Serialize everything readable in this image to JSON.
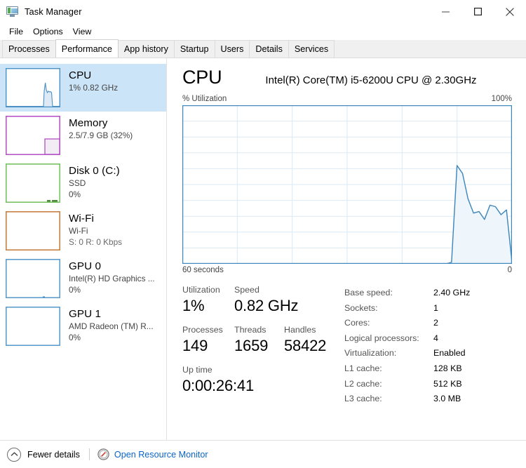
{
  "window": {
    "title": "Task Manager",
    "icon": "task-manager-icon",
    "controls": {
      "minimize": "minimize-icon",
      "maximize": "maximize-icon",
      "close": "close-icon"
    }
  },
  "menu": {
    "items": [
      "File",
      "Options",
      "View"
    ]
  },
  "tabs": {
    "items": [
      "Processes",
      "Performance",
      "App history",
      "Startup",
      "Users",
      "Details",
      "Services"
    ],
    "active": "Performance"
  },
  "sidebar": {
    "items": [
      {
        "title": "CPU",
        "sub1": "1%  0.82 GHz",
        "sub2": "",
        "color": "#4a90c4",
        "selected": true
      },
      {
        "title": "Memory",
        "sub1": "2.5/7.9 GB (32%)",
        "sub2": "",
        "color": "#b34ec4",
        "selected": false
      },
      {
        "title": "Disk 0 (C:)",
        "sub1": "SSD",
        "sub2": "0%",
        "color": "#70bf5a",
        "selected": false
      },
      {
        "title": "Wi-Fi",
        "sub1": "Wi-Fi",
        "sub2": "S: 0 R: 0 Kbps",
        "color": "#c4793a",
        "selected": false
      },
      {
        "title": "GPU 0",
        "sub1": "Intel(R) HD Graphics ...",
        "sub2": "0%",
        "color": "#4a90c4",
        "selected": false
      },
      {
        "title": "GPU 1",
        "sub1": "AMD Radeon (TM) R...",
        "sub2": "0%",
        "color": "#4a90c4",
        "selected": false
      }
    ]
  },
  "main": {
    "title": "CPU",
    "subtitle": "Intel(R) Core(TM) i5-6200U CPU @ 2.30GHz",
    "chart_axis_label": "% Utilization",
    "chart_max_label": "100%",
    "chart_time_label": "60 seconds",
    "chart_min_label": "0",
    "stats": {
      "utilization": {
        "label": "Utilization",
        "value": "1%"
      },
      "speed": {
        "label": "Speed",
        "value": "0.82 GHz"
      },
      "processes": {
        "label": "Processes",
        "value": "149"
      },
      "threads": {
        "label": "Threads",
        "value": "1659"
      },
      "handles": {
        "label": "Handles",
        "value": "58422"
      },
      "uptime": {
        "label": "Up time",
        "value": "0:00:26:41"
      }
    },
    "specs": [
      {
        "key": "Base speed:",
        "value": "2.40 GHz"
      },
      {
        "key": "Sockets:",
        "value": "1"
      },
      {
        "key": "Cores:",
        "value": "2"
      },
      {
        "key": "Logical processors:",
        "value": "4"
      },
      {
        "key": "Virtualization:",
        "value": "Enabled"
      },
      {
        "key": "L1 cache:",
        "value": "128 KB"
      },
      {
        "key": "L2 cache:",
        "value": "512 KB"
      },
      {
        "key": "L3 cache:",
        "value": "3.0 MB"
      }
    ]
  },
  "statusbar": {
    "collapse_icon": "chevron-up-icon",
    "fewer_details": "Fewer details",
    "resource_monitor_icon": "resource-monitor-icon",
    "resource_monitor": "Open Resource Monitor"
  },
  "colors": {
    "accent": "#0a64c8",
    "chart_line": "#4a90c4",
    "chart_fill": "#eef5fb",
    "selection": "#cce4f7"
  },
  "chart_data": {
    "type": "area",
    "title": "% Utilization",
    "xlabel": "60 seconds",
    "ylabel": "% Utilization",
    "xlim": [
      60,
      0
    ],
    "ylim": [
      0,
      100
    ],
    "grid": true,
    "gridlines": {
      "horizontal": 10,
      "vertical": 6
    },
    "series": [
      {
        "name": "CPU utilization",
        "x": [
          60,
          59,
          58,
          57,
          56,
          55,
          54,
          53,
          52,
          51,
          50,
          49,
          48,
          47,
          46,
          45,
          44,
          43,
          42,
          41,
          40,
          39,
          38,
          37,
          36,
          35,
          34,
          33,
          32,
          31,
          30,
          29,
          28,
          27,
          26,
          25,
          24,
          23,
          22,
          21,
          20,
          19,
          18,
          17,
          16,
          15,
          14,
          13,
          12,
          11,
          10,
          9,
          8,
          7,
          6,
          5,
          4,
          3,
          2,
          1,
          0
        ],
        "values": [
          0,
          0,
          0,
          0,
          0,
          0,
          0,
          0,
          0,
          0,
          0,
          0,
          0,
          0,
          0,
          0,
          0,
          0,
          0,
          0,
          0,
          0,
          0,
          0,
          0,
          0,
          0,
          0,
          0,
          0,
          0,
          0,
          0,
          0,
          0,
          0,
          0,
          0,
          0,
          0,
          0,
          0,
          0,
          0,
          0,
          0,
          0,
          0,
          0,
          1,
          62,
          57,
          41,
          32,
          33,
          28,
          37,
          36,
          31,
          34,
          1
        ]
      }
    ]
  }
}
